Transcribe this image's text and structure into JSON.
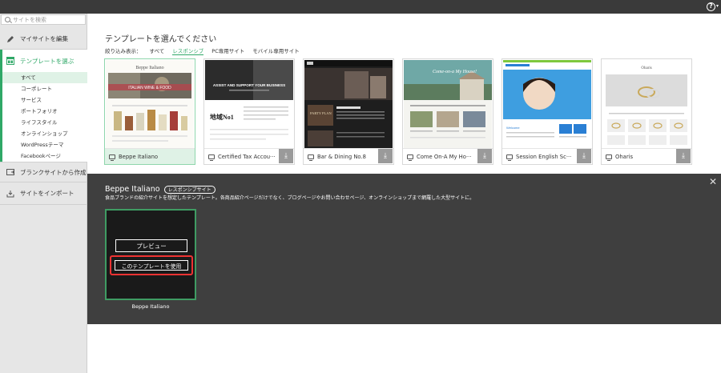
{
  "header": {
    "help_glyph": "?",
    "help_caret": "▾"
  },
  "sidebar": {
    "search_placeholder": "サイトを検索",
    "edit_label": "マイサイトを編集",
    "choose_label": "テンプレートを選ぶ",
    "categories": [
      "すべて",
      "コーポレート",
      "サービス",
      "ポートフォリオ",
      "ライフスタイル",
      "オンラインショップ",
      "WordPressテーマ",
      "Facebookページ"
    ],
    "blank_label": "ブランクサイトから作成",
    "import_label": "サイトをインポート",
    "accent": "#2fa867"
  },
  "main": {
    "title": "テンプレートを選んでください",
    "filter": {
      "label": "絞り込み表示：",
      "options": [
        "すべて",
        "レスポンシブ",
        "PC専用サイト",
        "モバイル専用サイト"
      ],
      "selected": "レスポンシブ"
    },
    "templates": [
      {
        "name": "Beppe Italiano",
        "thumb_title": "Beppe Italiano",
        "thumb_banner": "ITALIAN WINE & FOOD"
      },
      {
        "name": "Certified Tax Accou···",
        "thumb_title": "ASSIST AND SUPPORT YOUR BUSINESS",
        "thumb_big": "地域No1"
      },
      {
        "name": "Bar & Dining No.8",
        "thumb_title": "PARTY PLAN"
      },
      {
        "name": "Come On-A My Ho···",
        "thumb_title": "Come-on-a My House!"
      },
      {
        "name": "Session English Sc···",
        "thumb_title": "Welcome"
      },
      {
        "name": "Oharis",
        "thumb_title": "Oharis"
      }
    ],
    "download_glyph": "⤓"
  },
  "panel": {
    "title": "Beppe Italiano",
    "badge": "レスポンシブサイト",
    "description": "食品ブランドの紹介サイトを想定したテンプレート。各商品紹介ページだけでなく、ブログページやお問い合わせページ、オンラインショップまで網羅した大型サイトに。",
    "preview_label": "プレビュー",
    "use_label": "このテンプレートを使用",
    "preview_name": "Beppe Italiano",
    "close_glyph": "✕",
    "highlight_color": "#e33333"
  }
}
